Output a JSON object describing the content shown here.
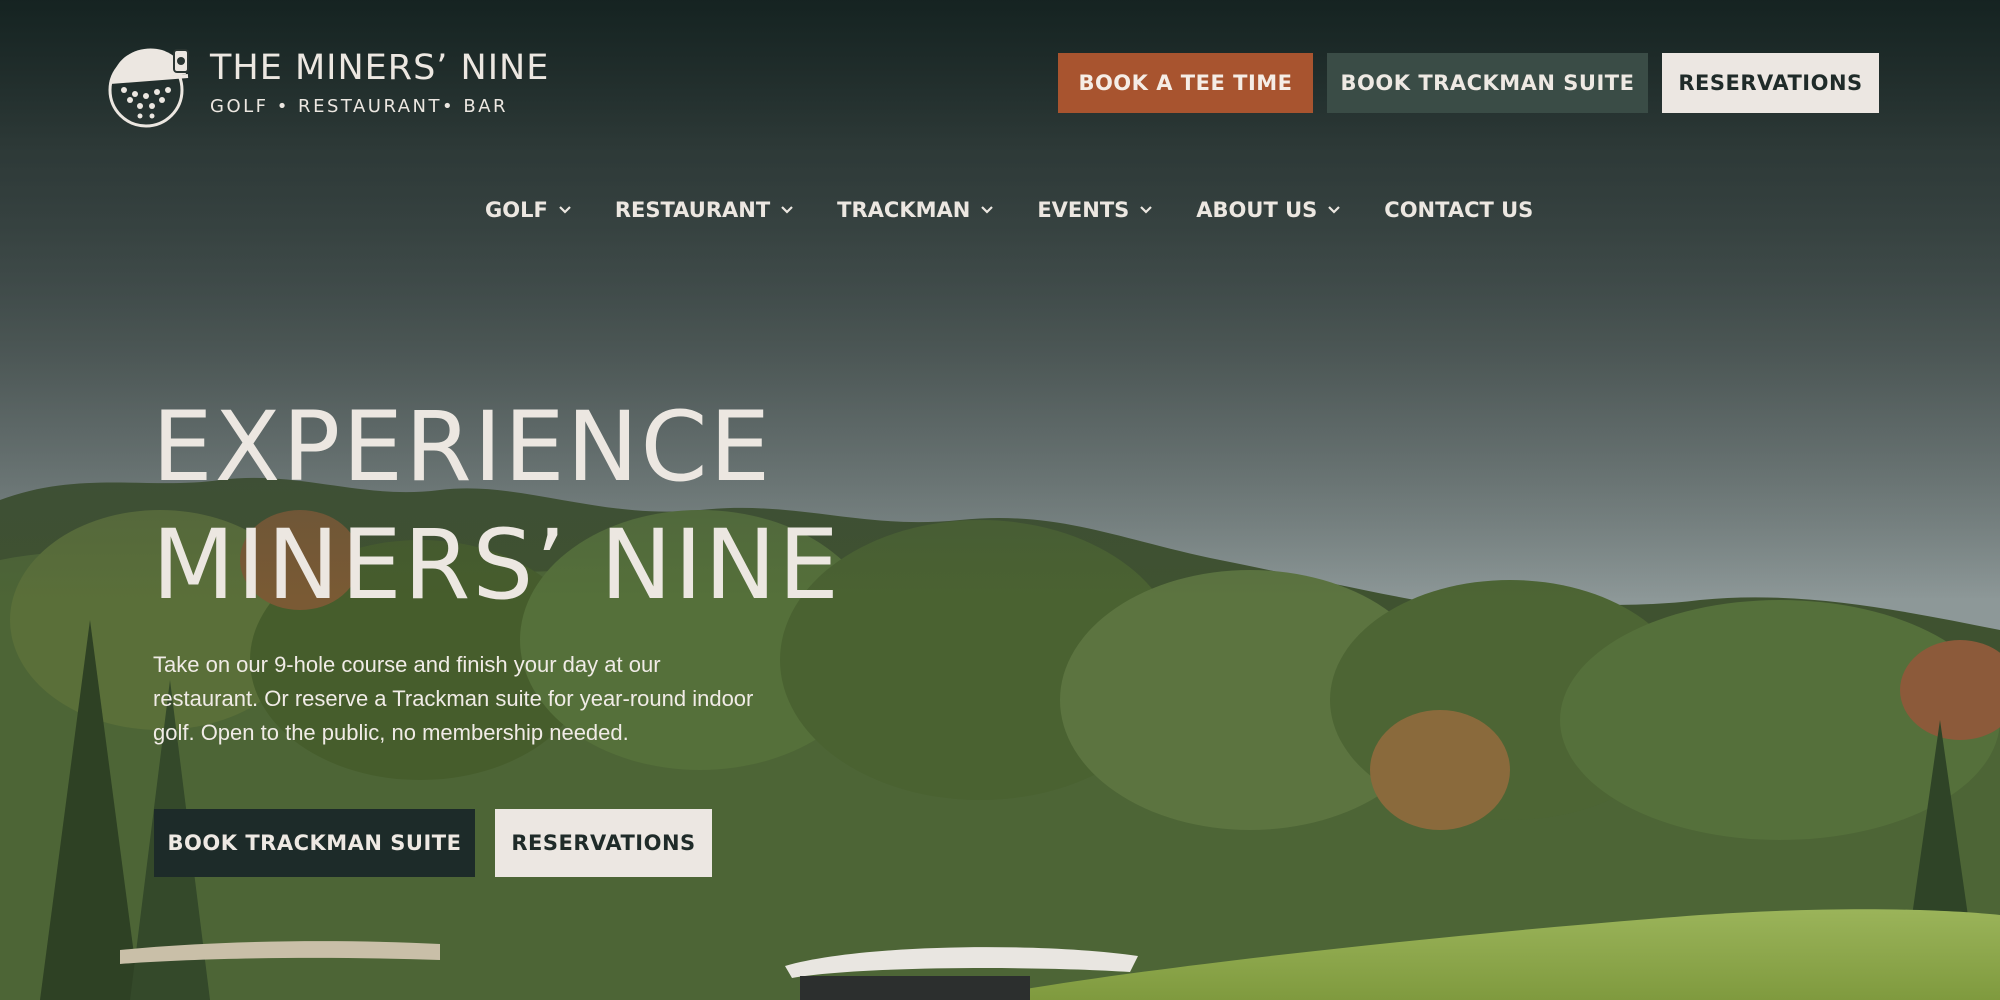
{
  "brand": {
    "title": "THE MINERS’ NINE",
    "subtitle": "GOLF • RESTAURANT• BAR",
    "logo_icon": "golf-ball-miner-helmet-icon"
  },
  "header_buttons": {
    "book_tee_time": "BOOK A TEE TIME",
    "book_trackman": "BOOK TRACKMAN SUITE",
    "reservations": "RESERVATIONS"
  },
  "nav": {
    "items": [
      {
        "label": "GOLF",
        "has_dropdown": true
      },
      {
        "label": "RESTAURANT",
        "has_dropdown": true
      },
      {
        "label": "TRACKMAN",
        "has_dropdown": true
      },
      {
        "label": "EVENTS",
        "has_dropdown": true
      },
      {
        "label": "ABOUT US",
        "has_dropdown": true
      },
      {
        "label": "CONTACT US",
        "has_dropdown": false
      }
    ]
  },
  "hero": {
    "headline_line1": "EXPERIENCE",
    "headline_line2": "MINERS’ NINE",
    "description": "Take on our 9-hole course and finish your day at our restaurant. Or reserve a Trackman suite for year-round indoor golf. Open to the public, no membership needed.",
    "cta_primary": "BOOK TRACKMAN SUITE",
    "cta_secondary": "RESERVATIONS"
  },
  "colors": {
    "accent_orange": "#a8542f",
    "dark_green": "#1d2b29",
    "muted_green": "#3a4c46",
    "cream": "#ece7e2"
  }
}
